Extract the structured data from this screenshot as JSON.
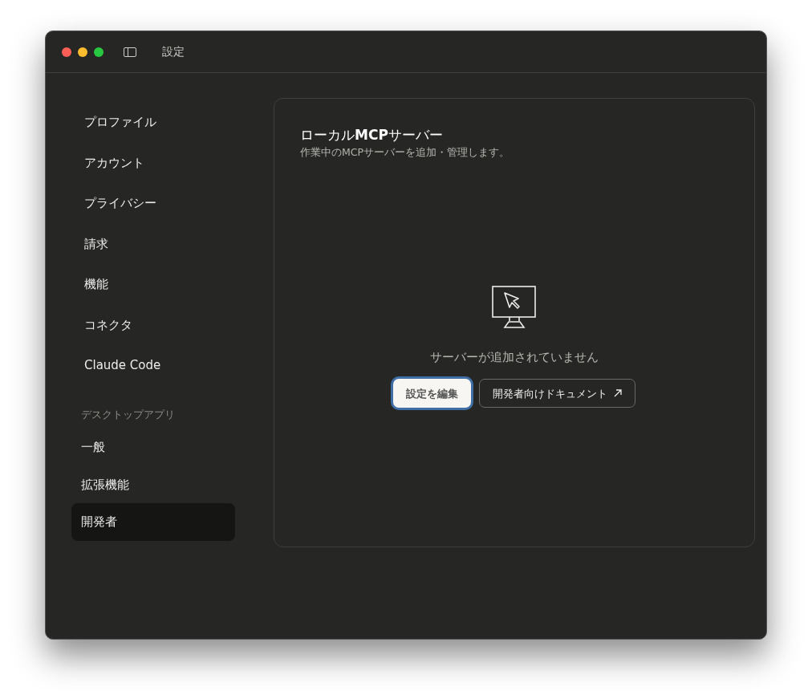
{
  "window": {
    "title": "設定"
  },
  "sidebar": {
    "sections": [
      {
        "items": [
          {
            "label": "プロファイル",
            "selected": false
          },
          {
            "label": "アカウント",
            "selected": false
          },
          {
            "label": "プライバシー",
            "selected": false
          },
          {
            "label": "請求",
            "selected": false
          },
          {
            "label": "機能",
            "selected": false
          },
          {
            "label": "コネクタ",
            "selected": false
          },
          {
            "label": "Claude Code",
            "selected": false
          }
        ]
      },
      {
        "label": "デスクトップアプリ",
        "items": [
          {
            "label": "一般",
            "selected": false
          },
          {
            "label": "拡張機能",
            "selected": false
          },
          {
            "label": "開発者",
            "selected": true
          }
        ]
      }
    ]
  },
  "panel": {
    "title": "ローカル**MCP**サーバー",
    "subtitle": "作業中のMCPサーバーを追加・管理します。",
    "empty_message": "サーバーが追加されていません",
    "buttons": [
      {
        "label": "設定を編集",
        "kind": "primary",
        "focused": true
      },
      {
        "label": "開発者向けドキュメント",
        "kind": "secondary",
        "focused": false
      }
    ]
  }
}
